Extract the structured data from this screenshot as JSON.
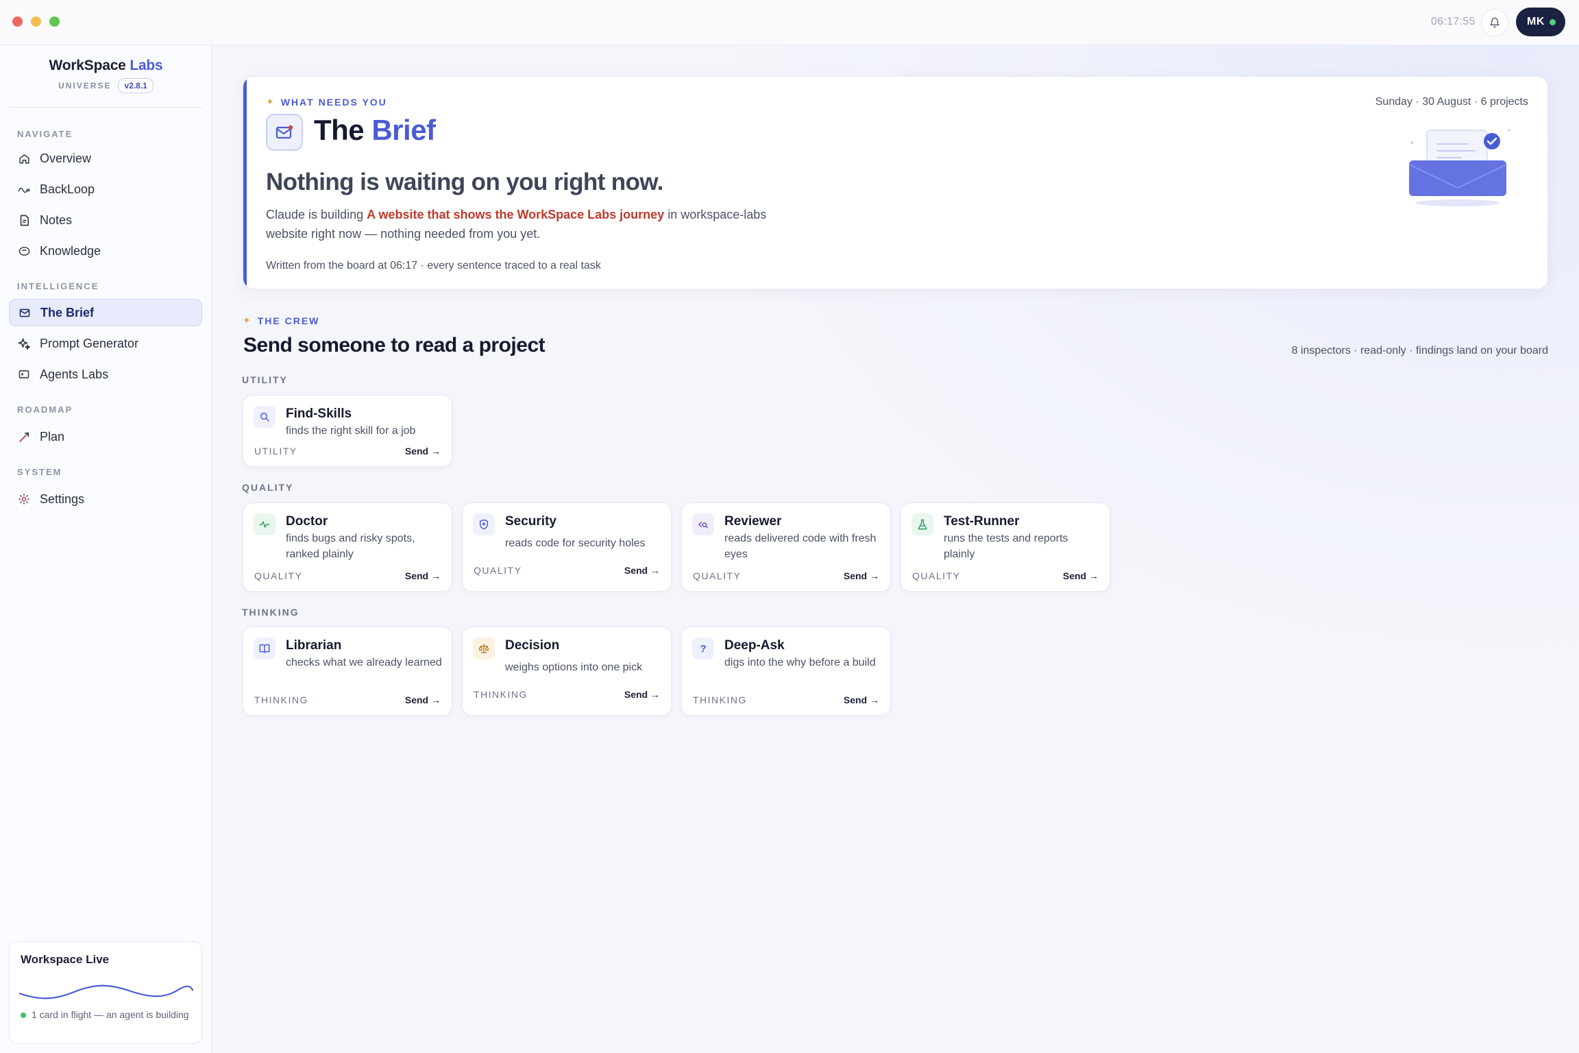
{
  "topbar": {
    "clock": "06:17:55",
    "avatar_initials": "MK"
  },
  "brand": {
    "name_main": "WorkSpace",
    "name_accent": "Labs",
    "sub": "UNIVERSE",
    "version": "v2.8.1"
  },
  "sidebar": {
    "sections": {
      "navigate": "NAVIGATE",
      "intelligence": "INTELLIGENCE",
      "roadmap": "ROADMAP",
      "system": "SYSTEM"
    },
    "items": [
      {
        "label": "Overview",
        "icon": "home-icon"
      },
      {
        "label": "BackLoop",
        "icon": "loop-icon"
      },
      {
        "label": "Notes",
        "icon": "note-icon"
      },
      {
        "label": "Knowledge",
        "icon": "brain-icon"
      },
      {
        "label": "The Brief",
        "icon": "mail-icon",
        "active": true
      },
      {
        "label": "Prompt Generator",
        "icon": "sparkle-icon"
      },
      {
        "label": "Agents Labs",
        "icon": "terminal-icon"
      },
      {
        "label": "Plan",
        "icon": "trend-icon"
      },
      {
        "label": "Settings",
        "icon": "gear-icon"
      }
    ],
    "live": {
      "title": "Workspace Live",
      "status": "1 card in flight — an agent is building"
    }
  },
  "brief": {
    "eyebrow": "WHAT NEEDS YOU",
    "title_main": "The",
    "title_accent": "Brief",
    "meta": "Sunday · 30 August · 6 projects",
    "headline": "Nothing is waiting on you right now.",
    "body_pre": "Claude is building ",
    "body_highlight": "A website that shows the WorkSpace Labs journey",
    "body_post": " in workspace-labs website right now — nothing needed from you yet.",
    "footer": "Written from the board at 06:17 · every sentence traced to a real task"
  },
  "crew": {
    "eyebrow": "THE CREW",
    "title": "Send someone to read a project",
    "meta": "8 inspectors · read-only · findings land on your board",
    "send_label": "Send →",
    "groups": [
      {
        "label": "UTILITY",
        "cards": [
          {
            "name": "Find-Skills",
            "desc": "finds the right skill for a job",
            "tag": "UTILITY",
            "icon": "search-icon"
          }
        ]
      },
      {
        "label": "QUALITY",
        "cards": [
          {
            "name": "Doctor",
            "desc": "finds bugs and risky spots, ranked plainly",
            "tag": "QUALITY",
            "icon": "pulse-icon"
          },
          {
            "name": "Security",
            "desc": "reads code for security holes",
            "tag": "QUALITY",
            "icon": "shield-icon"
          },
          {
            "name": "Reviewer",
            "desc": "reads delivered code with fresh eyes",
            "tag": "QUALITY",
            "icon": "code-review-icon"
          },
          {
            "name": "Test-Runner",
            "desc": "runs the tests and reports plainly",
            "tag": "QUALITY",
            "icon": "flask-icon"
          }
        ]
      },
      {
        "label": "THINKING",
        "cards": [
          {
            "name": "Librarian",
            "desc": "checks what we already learned",
            "tag": "THINKING",
            "icon": "book-icon"
          },
          {
            "name": "Decision",
            "desc": "weighs options into one pick",
            "tag": "THINKING",
            "icon": "scale-icon"
          },
          {
            "name": "Deep-Ask",
            "desc": "digs into the why before a build",
            "tag": "THINKING",
            "icon": "question-icon"
          }
        ]
      }
    ]
  },
  "colors": {
    "accent": "#4a5bd4",
    "highlight": "#c0392b",
    "sidebar_active_bg": "#e8ebfb",
    "live_dot": "#3fbf6d"
  }
}
